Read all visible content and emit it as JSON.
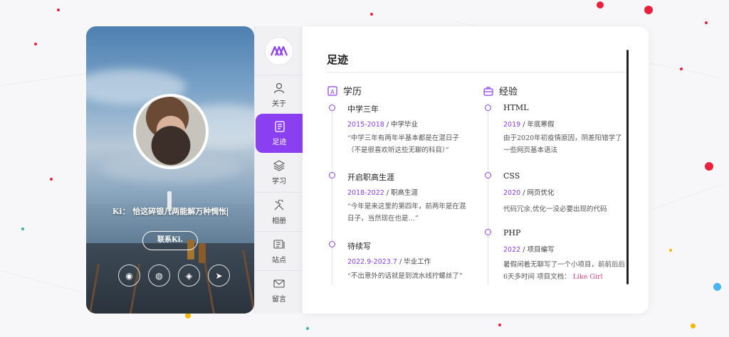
{
  "profile": {
    "intro": "Ki： 恰这碎银几两能解万种惆怅",
    "contact_label": "联系Ki.",
    "social": [
      {
        "icon": "weibo-icon",
        "glyph": "◉"
      },
      {
        "icon": "wechat-icon",
        "glyph": "◍"
      },
      {
        "icon": "qq-icon",
        "glyph": "◈"
      },
      {
        "icon": "send-icon",
        "glyph": "➤"
      }
    ]
  },
  "nav": {
    "items": [
      {
        "label": "关于",
        "icon": "user-icon"
      },
      {
        "label": "足迹",
        "icon": "footprint-icon",
        "active": true
      },
      {
        "label": "学习",
        "icon": "layers-icon"
      },
      {
        "label": "相册",
        "icon": "tools-icon"
      },
      {
        "label": "站点",
        "icon": "site-icon"
      },
      {
        "label": "留言",
        "icon": "message-icon"
      }
    ]
  },
  "main": {
    "title": "足迹",
    "education": {
      "heading": "学历",
      "items": [
        {
          "title": "中学三年",
          "date": "2015-2018",
          "tag": "中学毕业",
          "desc": [
            "“中学三年有两年半基本都是在混日子",
            "（不是很喜欢听这些无聊的科目）”"
          ]
        },
        {
          "title": "开启职高生涯",
          "date": "2018-2022",
          "tag": "职高生涯",
          "desc": [
            "“今年是来这里的第四年，前两年是在混",
            "日子，当然现在也是…”"
          ]
        },
        {
          "title": "待续写",
          "date": "2022.9-2023.7",
          "tag": "毕业工作",
          "desc": [
            "“不出意外的话就是到流水线拧螺丝了”"
          ]
        }
      ]
    },
    "experience": {
      "heading": "经验",
      "items": [
        {
          "title": "HTML",
          "date": "2019",
          "tag": "年底寒假",
          "desc": [
            "由于2020年初疫情原因，阴差阳错学了",
            "一些网页基本语法"
          ]
        },
        {
          "title": "CSS",
          "date": "2020",
          "tag": "网页优化",
          "desc": [
            "代码冗余,优化一没必要出现的代码"
          ]
        },
        {
          "title": "PHP",
          "date": "2022",
          "tag": "项目编写",
          "desc": [
            "暑假闲着无聊写了一个小项目，前前后后",
            "6天多时间 项目文档："
          ],
          "link": "Like Girl"
        }
      ]
    }
  },
  "colors": {
    "accent": "#8a3ff0",
    "link": "#e0457b"
  }
}
